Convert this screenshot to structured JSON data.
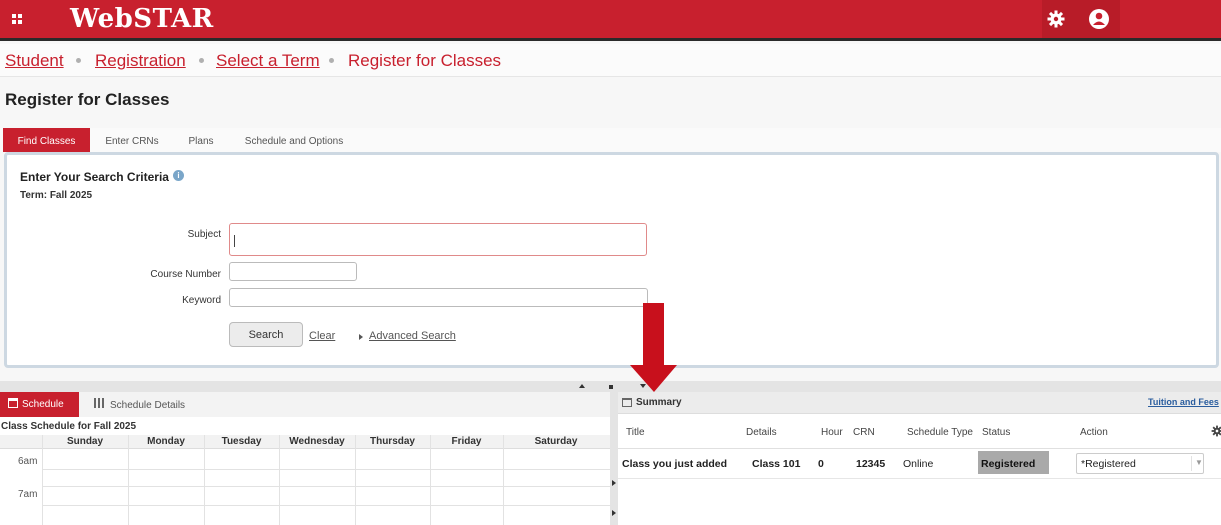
{
  "app": {
    "name": "WebSTAR",
    "brand_color": "#c8202e",
    "menu_icon": "grid-icon",
    "settings_icon": "gear-icon",
    "account_icon": "user-icon"
  },
  "breadcrumb": {
    "items": [
      "Student",
      "Registration",
      "Select a Term",
      "Register for Classes"
    ]
  },
  "page": {
    "title": "Register for Classes"
  },
  "tabs": [
    "Find Classes",
    "Enter CRNs",
    "Plans",
    "Schedule and Options"
  ],
  "search": {
    "title": "Enter Your Search Criteria",
    "info_icon": "info-icon",
    "term_label": "Term: Fall 2025",
    "subject_label": "Subject",
    "subject_value": "",
    "course_number_label": "Course Number",
    "course_number_value": "",
    "keyword_label": "Keyword",
    "keyword_value": "",
    "search_button": "Search",
    "clear_link": "Clear",
    "advanced_link": "Advanced Search"
  },
  "schedule": {
    "tab_active": "Schedule",
    "tab_details": "Schedule Details",
    "caption": "Class Schedule for Fall 2025",
    "days": [
      "Sunday",
      "Monday",
      "Tuesday",
      "Wednesday",
      "Thursday",
      "Friday",
      "Saturday"
    ],
    "times": [
      "6am",
      "7am"
    ]
  },
  "summary": {
    "label": "Summary",
    "tuition_link": "Tuition and Fees",
    "columns": [
      "Title",
      "Details",
      "Hour",
      "CRN",
      "Schedule Type",
      "Status",
      "Action"
    ],
    "row": {
      "title": "Class you just added",
      "details": "Class 101",
      "hour": "0",
      "crn": "12345",
      "schedule_type": "Online",
      "status": "Registered",
      "action": "*Registered"
    },
    "status_color": "#a9a9a9"
  },
  "annotation": {
    "arrow_color": "#c8101c"
  }
}
